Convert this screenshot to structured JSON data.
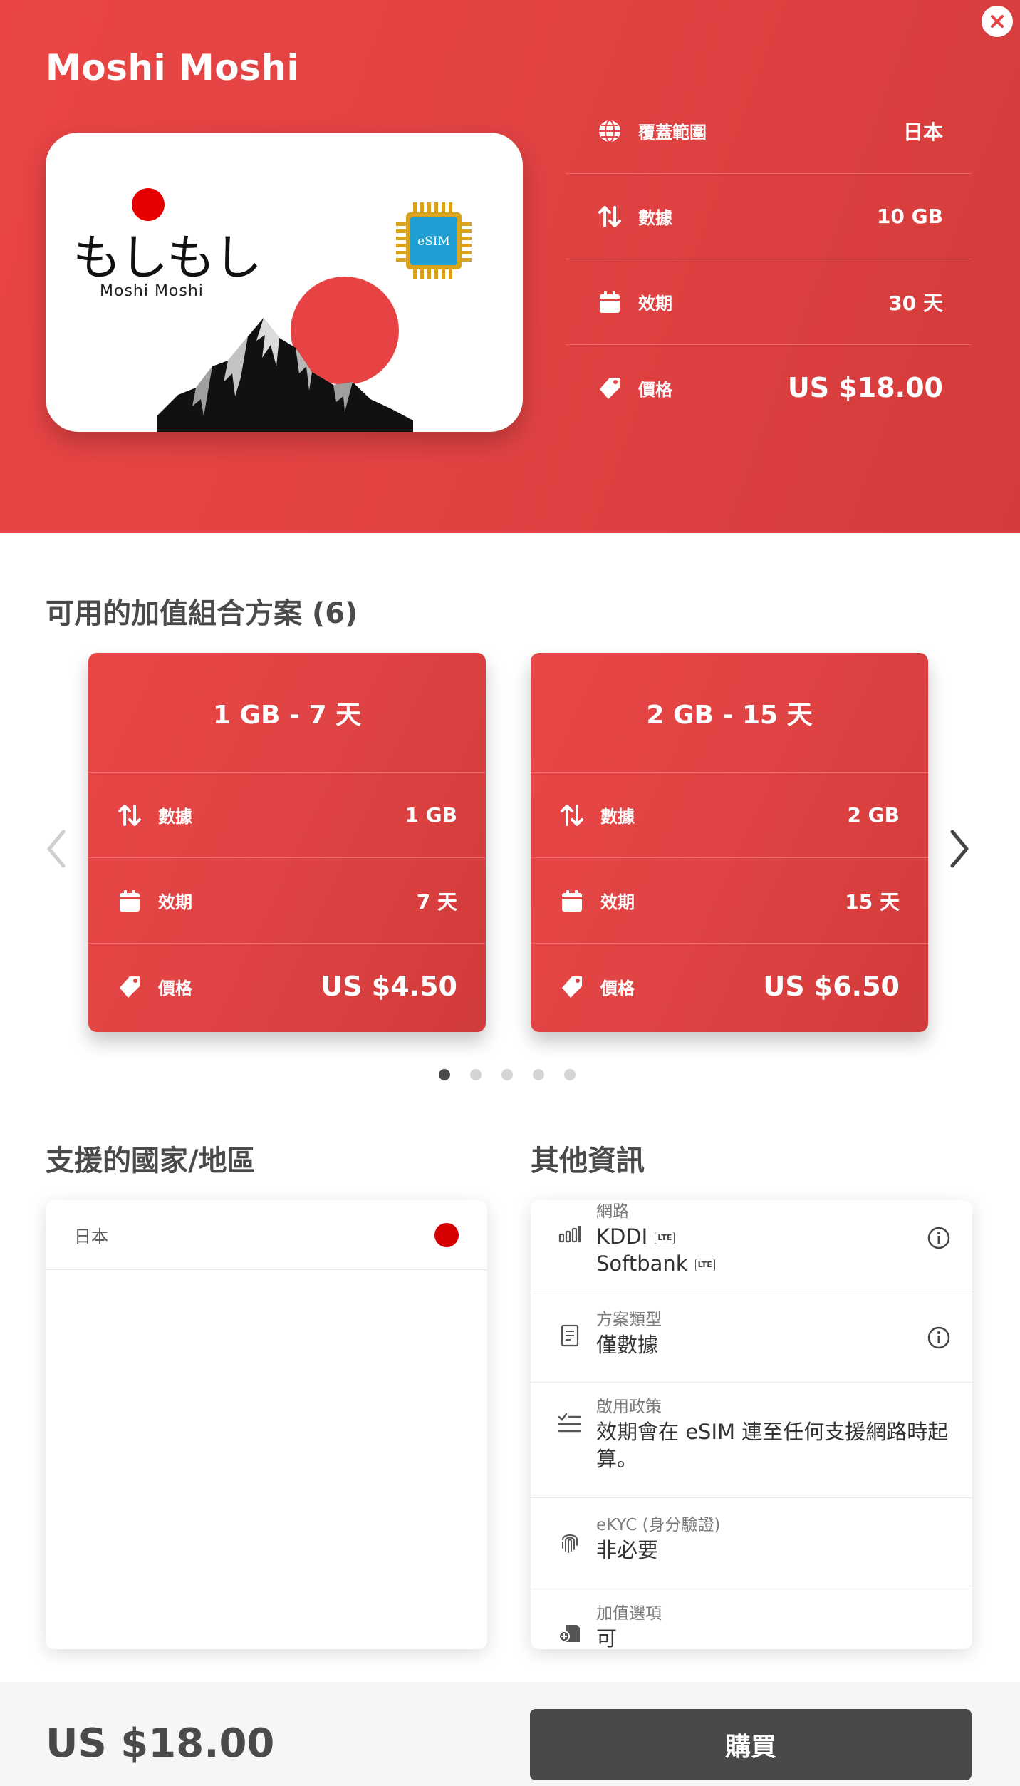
{
  "header": {
    "title": "Moshi Moshi",
    "close_icon": "close-icon",
    "card": {
      "logo_jp": "もしもし",
      "logo_en": "Moshi Moshi",
      "chip_label": "eSIM"
    },
    "specs": [
      {
        "icon": "globe-icon",
        "label": "覆蓋範圍",
        "value": "日本"
      },
      {
        "icon": "data-arrows-icon",
        "label": "數據",
        "value": "10 GB"
      },
      {
        "icon": "calendar-icon",
        "label": "效期",
        "value": "30 天"
      },
      {
        "icon": "price-tag-icon",
        "label": "價格",
        "value": "US $18.00"
      }
    ],
    "accent_color": "#e34444"
  },
  "topups": {
    "title": "可用的加值組合方案 (6)",
    "cards": [
      {
        "title": "1 GB - 7 天",
        "data_label": "數據",
        "data_value": "1 GB",
        "validity_label": "效期",
        "validity_value": "7 天",
        "price_label": "價格",
        "price_value": "US $4.50"
      },
      {
        "title": "2 GB - 15 天",
        "data_label": "數據",
        "data_value": "2 GB",
        "validity_label": "效期",
        "validity_value": "15 天",
        "price_label": "價格",
        "price_value": "US $6.50"
      }
    ],
    "prev_icon": "chevron-left-icon",
    "next_icon": "chevron-right-icon",
    "pagination": {
      "total": 5,
      "active": 1
    }
  },
  "countries": {
    "title": "支援的國家/地區",
    "items": [
      {
        "name": "日本",
        "flag": "japan-flag-icon"
      }
    ]
  },
  "info": {
    "title": "其他資訊",
    "network": {
      "caption": "網路",
      "carriers": [
        {
          "name": "KDDI",
          "badge": "LTE"
        },
        {
          "name": "Softbank",
          "badge": "LTE"
        }
      ]
    },
    "plan_type": {
      "caption": "方案類型",
      "value": "僅數據"
    },
    "activation": {
      "caption": "啟用政策",
      "value": "效期會在 eSIM 連至任何支援網路時起算。"
    },
    "ekyc": {
      "caption": "eKYC (身分驗證)",
      "value": "非必要"
    },
    "topup_option": {
      "caption": "加值選項",
      "value": "可"
    }
  },
  "footer": {
    "price": "US $18.00",
    "buy_label": "購買",
    "button_color": "#494949"
  }
}
